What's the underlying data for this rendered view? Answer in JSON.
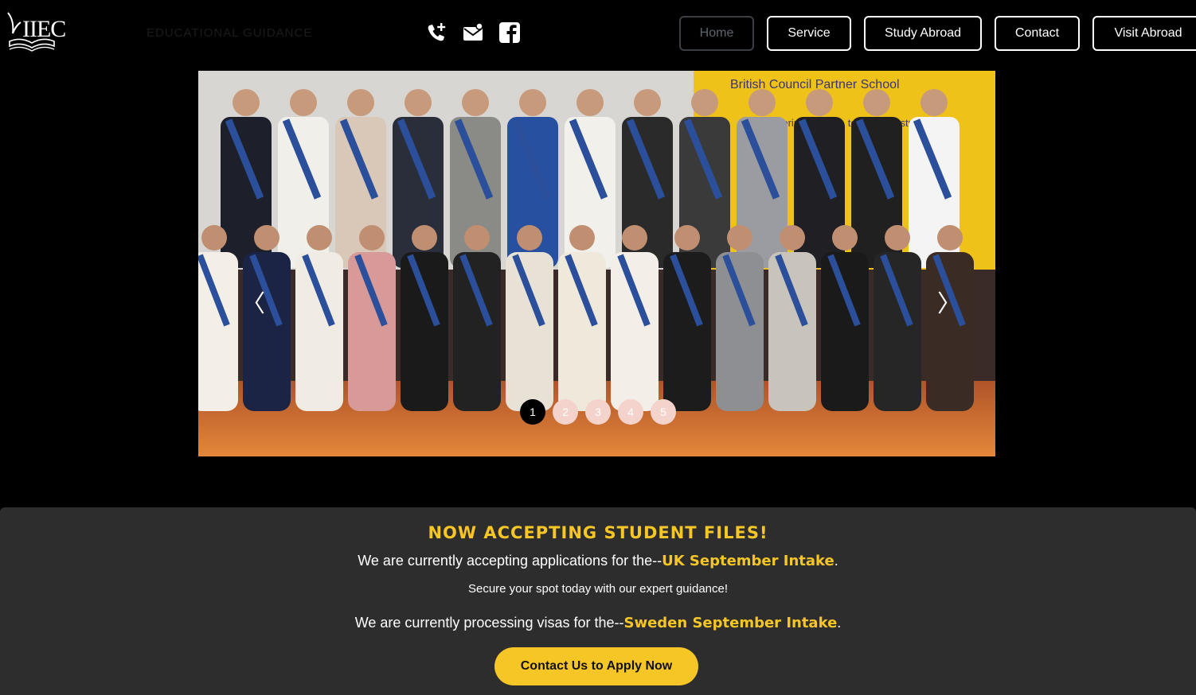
{
  "header": {
    "logo_text": "IIEC",
    "tagline": "EDUCATIONAL GUIDANCE",
    "nav": [
      {
        "label": "Home",
        "active": true
      },
      {
        "label": "Service",
        "active": false
      },
      {
        "label": "Study Abroad",
        "active": false
      },
      {
        "label": "Contact",
        "active": false
      },
      {
        "label": "Visit Abroad",
        "active": false
      }
    ],
    "contact_icons": [
      "phone-plus-icon",
      "mail-icon",
      "facebook-icon"
    ]
  },
  "slider": {
    "banner_text": "British Council Partner School",
    "banner_subtext": "Empowering leaders, teachers & students",
    "prev_arrow": "〈",
    "next_arrow": "〉",
    "dots": [
      "1",
      "2",
      "3",
      "4",
      "5"
    ],
    "active_dot": 1
  },
  "notice": {
    "title": "NOW ACCEPTING STUDENT FILES!",
    "line1_prefix": "We are currently accepting applications for the--",
    "line1_highlight": "UK September Intake",
    "line1_suffix": ".",
    "line2": "Secure your spot today with our expert guidance!",
    "line3_prefix": "We are currently processing visas for the--",
    "line3_highlight": "Sweden September Intake",
    "line3_suffix": ".",
    "cta_label": "Contact Us to Apply Now"
  },
  "colors": {
    "accent": "#f6c627",
    "notice_bg": "#2d2d2d",
    "page_bg": "#000000"
  }
}
